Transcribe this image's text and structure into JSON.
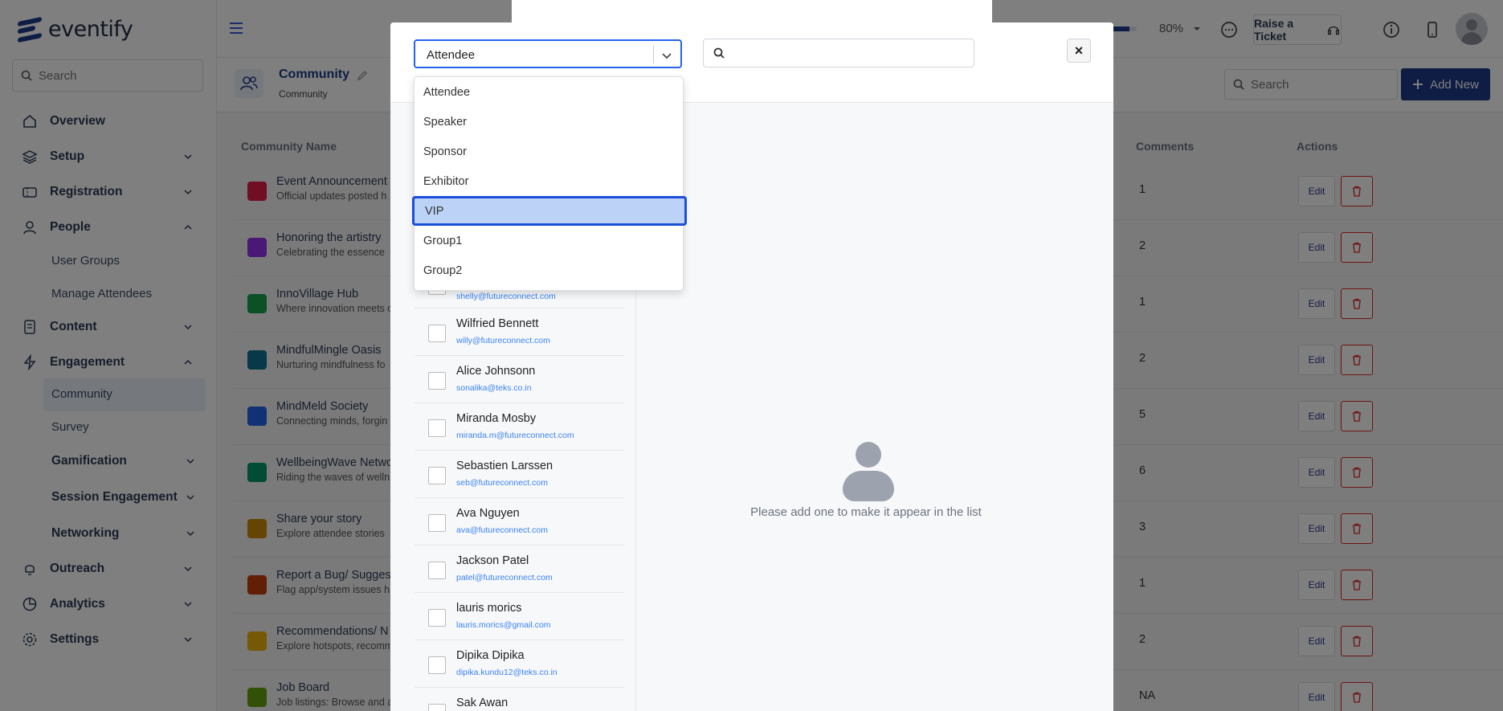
{
  "brand": {
    "name": "eventify"
  },
  "sidebar": {
    "search_placeholder": "Search",
    "items": [
      {
        "label": "Overview"
      },
      {
        "label": "Setup"
      },
      {
        "label": "Registration"
      },
      {
        "label": "People"
      },
      {
        "label": "Content"
      },
      {
        "label": "Engagement"
      },
      {
        "label": "Outreach"
      },
      {
        "label": "Analytics"
      },
      {
        "label": "Settings"
      }
    ],
    "people_sub": [
      "User Groups",
      "Manage Attendees"
    ],
    "engagement_sub": [
      "Community",
      "Survey",
      "Gamification",
      "Session Engagement",
      "Networking"
    ]
  },
  "header": {
    "progress_percent": 80,
    "progress_label": "80%",
    "raise_ticket": "Raise a Ticket"
  },
  "page": {
    "title": "Community",
    "breadcrumb": "Community",
    "search_placeholder": "Search",
    "add_new": "Add New"
  },
  "table": {
    "headers": {
      "name": "Community Name",
      "comments": "Comments",
      "actions": "Actions"
    },
    "edit_label": "Edit",
    "rows": [
      {
        "name": "Event Announcement",
        "desc": "Official updates posted h",
        "comments": "1",
        "color": "#e11d48"
      },
      {
        "name": "Honoring the artistry",
        "desc": "Celebrating the essence",
        "comments": "2",
        "color": "#9333ea"
      },
      {
        "name": "InnoVillage Hub",
        "desc": "Where innovation meets c",
        "comments": "1",
        "color": "#16a34a"
      },
      {
        "name": "MindfulMingle Oasis",
        "desc": "Nurturing mindfulness fo",
        "comments": "2",
        "color": "#0e7490"
      },
      {
        "name": "MindMeld Society",
        "desc": "Connecting minds, forgin",
        "comments": "5",
        "color": "#2563eb"
      },
      {
        "name": "WellbeingWave Netwo",
        "desc": "Riding the waves of welln",
        "comments": "6",
        "color": "#059669"
      },
      {
        "name": "Share your story",
        "desc": "Explore attendee stories",
        "comments": "3",
        "color": "#ca8a04"
      },
      {
        "name": "Report a Bug/ Sugges",
        "desc": "Flag app/system issues h",
        "comments": "1",
        "color": "#c2410c"
      },
      {
        "name": "Recommendations/ N",
        "desc": "Explore hotspots, recomm",
        "comments": "2",
        "color": "#eab308"
      },
      {
        "name": "Job Board",
        "desc": "Job listings: Browse and a",
        "comments": "NA",
        "color": "#65a30d"
      }
    ]
  },
  "modal": {
    "select_value": "Attendee",
    "options": [
      "Attendee",
      "Speaker",
      "Sponsor",
      "Exhibitor",
      "VIP",
      "Group1",
      "Group2"
    ],
    "highlighted_option": "VIP",
    "people": [
      {
        "name": "",
        "email": "shelly@futureconnect.com"
      },
      {
        "name": "Wilfried Bennett",
        "email": "willy@futureconnect.com"
      },
      {
        "name": "Alice Johnsonn",
        "email": "sonalika@teks.co.in"
      },
      {
        "name": "Miranda Mosby",
        "email": "miranda.m@futureconnect.com"
      },
      {
        "name": "Sebastien Larssen",
        "email": "seb@futureconnect.com"
      },
      {
        "name": "Ava Nguyen",
        "email": "ava@futureconnect.com"
      },
      {
        "name": "Jackson Patel",
        "email": "patel@futureconnect.com"
      },
      {
        "name": "lauris morics",
        "email": "lauris.morics@gmail.com"
      },
      {
        "name": "Dipika Dipika",
        "email": "dipika.kundu12@teks.co.in"
      },
      {
        "name": "Sak Awan",
        "email": ""
      }
    ],
    "empty_message": "Please add one to make it appear in the list"
  },
  "colors": {
    "brand": "#1e3a8a",
    "accent": "#2563eb",
    "danger": "#dc2626",
    "highlight": "#bcd3f7"
  }
}
